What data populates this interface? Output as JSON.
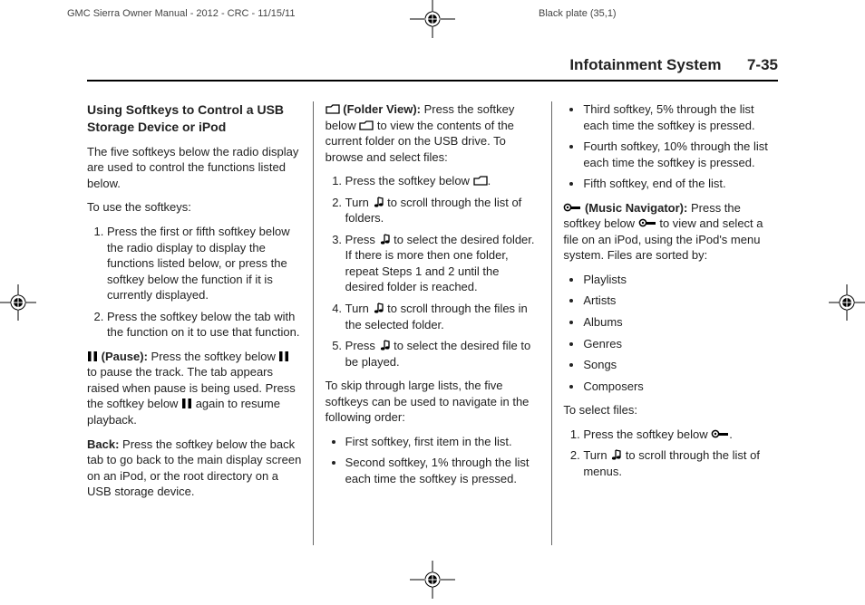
{
  "crop": {
    "left_text": "GMC Sierra Owner Manual - 2012 - CRC - 11/15/11",
    "right_text": "Black plate (35,1)"
  },
  "header": {
    "title": "Infotainment System",
    "page": "7-35"
  },
  "section_title": "Using Softkeys to Control a USB Storage Device or iPod",
  "intro_p1": "The five softkeys below the radio display are used to control the functions listed below.",
  "intro_p2": "To use the softkeys:",
  "use_list": [
    "Press the first or fifth softkey below the radio display to display the functions listed below, or press the softkey below the function if it is currently displayed.",
    "Press the softkey below the tab with the function on it to use that function."
  ],
  "pause_label": "(Pause):",
  "pause_a": "Press the softkey below",
  "pause_b": "to pause the track. The tab appears raised when pause is being used. Press the softkey below",
  "pause_c": "again to resume playback.",
  "back_label": "Back:",
  "back_text": "Press the softkey below the back tab to go back to the main display screen on an iPod, or the root directory on a USB storage device.",
  "folder_label": "(Folder View):",
  "folder_a": "Press the softkey below",
  "folder_b": "to view the contents of the current folder on the USB drive. To browse and select files:",
  "folder_steps": {
    "s1a": "Press the softkey below",
    "s1b": ".",
    "s2a": "Turn",
    "s2b": "to scroll through the list of folders.",
    "s3a": "Press",
    "s3b": "to select the desired folder. If there is more then one folder, repeat Steps 1 and 2 until the desired folder is reached.",
    "s4a": "Turn",
    "s4b": "to scroll through the files in the selected folder.",
    "s5a": "Press",
    "s5b": "to select the desired file to be played."
  },
  "skip_intro": "To skip through large lists, the five softkeys can be used to navigate in the following order:",
  "skip_items": [
    "First softkey, first item in the list.",
    "Second softkey, 1% through the list each time the softkey is pressed.",
    "Third softkey, 5% through the list each time the softkey is pressed.",
    "Fourth softkey, 10% through the list each time the softkey is pressed.",
    "Fifth softkey, end of the list."
  ],
  "nav_label": "(Music Navigator):",
  "nav_a": "Press the softkey below",
  "nav_b": "to view and select a file on an iPod, using the iPod's menu system. Files are sorted by:",
  "nav_categories": [
    "Playlists",
    "Artists",
    "Albums",
    "Genres",
    "Songs",
    "Composers"
  ],
  "select_intro": "To select files:",
  "select_steps": {
    "s1a": "Press the softkey below",
    "s1b": ".",
    "s2a": "Turn",
    "s2b": "to scroll through the list of menus."
  }
}
